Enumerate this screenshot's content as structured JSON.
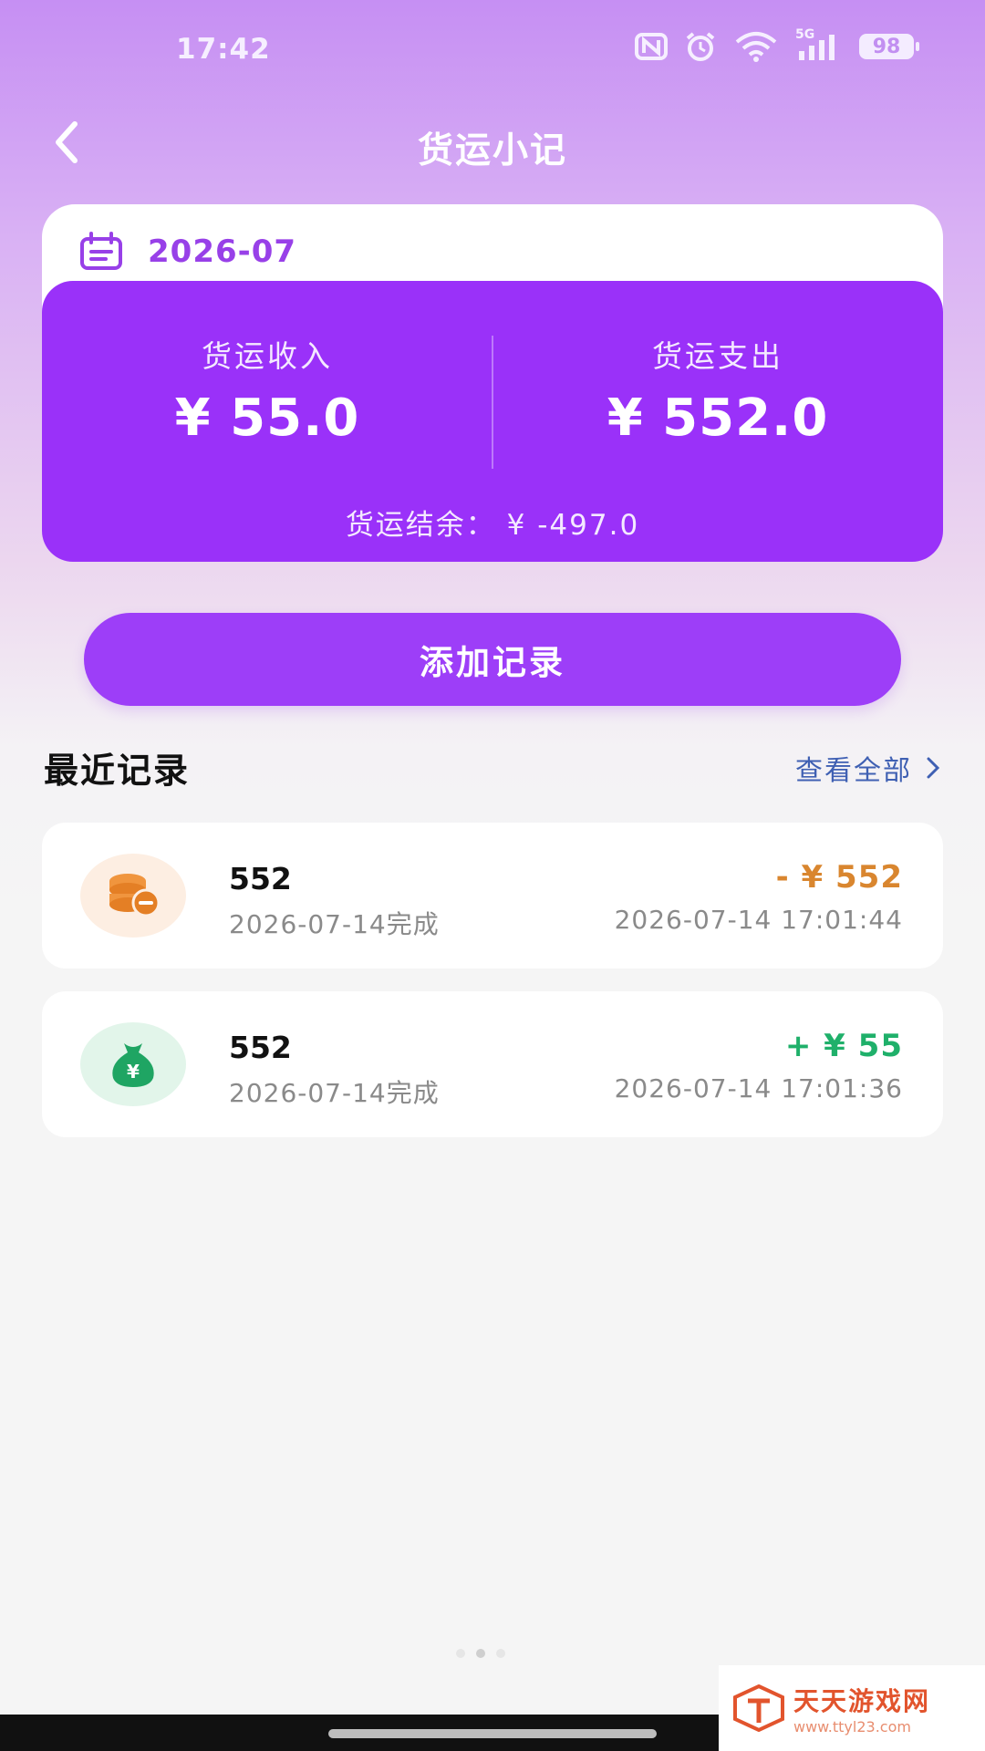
{
  "status": {
    "time": "17:42",
    "network": "5G",
    "battery": "98"
  },
  "header": {
    "title": "货运小记"
  },
  "month": {
    "label": "2026-07"
  },
  "summary": {
    "income_label": "货运收入",
    "income_value": "¥ 55.0",
    "expense_label": "货运支出",
    "expense_value": "¥ 552.0",
    "balance_label": "货运结余：",
    "balance_value": "¥ -497.0"
  },
  "add_button": {
    "label": "添加记录"
  },
  "recent": {
    "title": "最近记录",
    "view_all": "查看全部"
  },
  "records": [
    {
      "name": "552",
      "date": "2026-07-14完成",
      "amount": "- ¥ 552",
      "time": "2026-07-14 17:01:44",
      "type": "expense",
      "icon": "coins-icon",
      "amount_color": "#d9862f"
    },
    {
      "name": "552",
      "date": "2026-07-14完成",
      "amount": "+ ¥ 55",
      "time": "2026-07-14 17:01:36",
      "type": "income",
      "icon": "money-bag-icon",
      "amount_color": "#1fb06a"
    }
  ],
  "watermark": {
    "main": "天天游戏网",
    "sub": "www.ttyl23.com"
  },
  "colors": {
    "accent": "#9a31f9",
    "expense": "#d9862f",
    "income": "#1fb06a",
    "link": "#3f60b3"
  }
}
